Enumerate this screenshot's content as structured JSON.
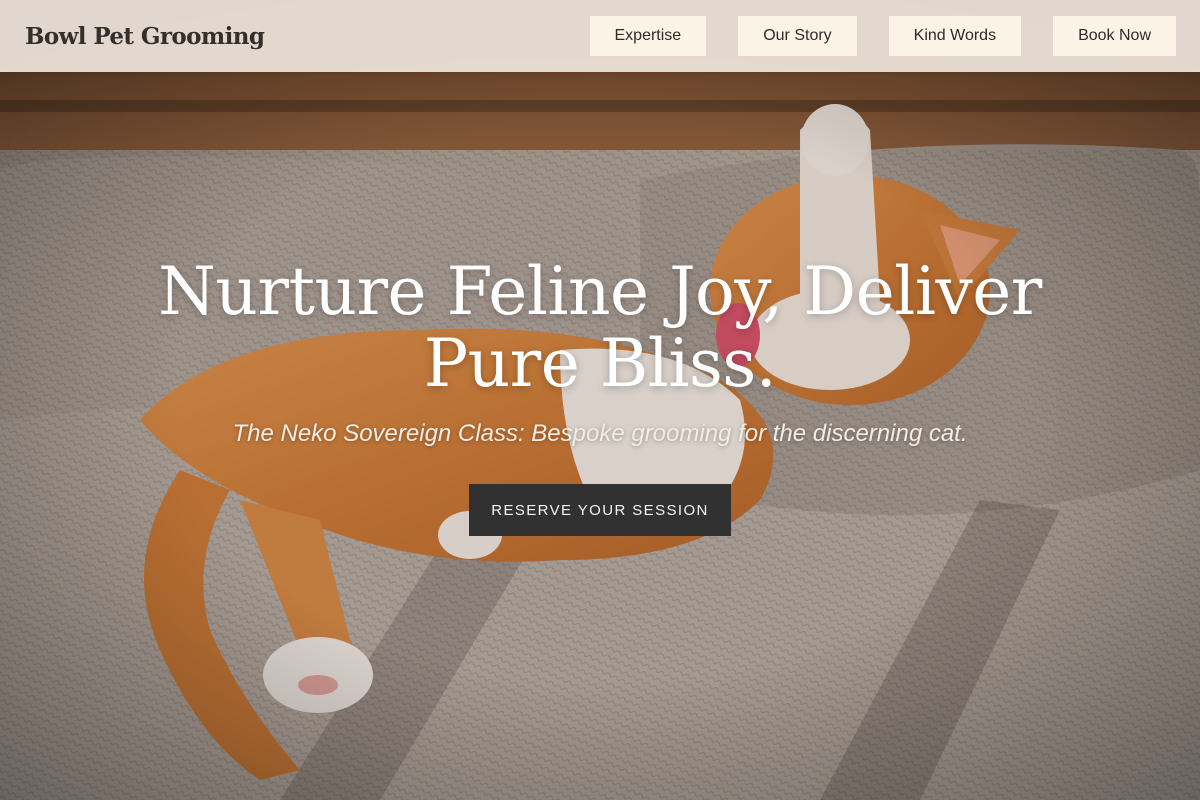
{
  "brand": {
    "name": "Bowl Pet Grooming"
  },
  "nav": {
    "items": [
      {
        "label": "Expertise"
      },
      {
        "label": "Our Story"
      },
      {
        "label": "Kind Words"
      },
      {
        "label": "Book Now"
      }
    ]
  },
  "hero": {
    "headline": "Nurture Feline Joy, Deliver Pure Bliss.",
    "subheadline": "The Neko Sovereign Class: Bespoke grooming for the discerning cat.",
    "cta_label": "RESERVE YOUR SESSION",
    "image": "orange-tabby-cat-on-sofa"
  },
  "colors": {
    "nav_bg": "#eee4db",
    "nav_button_bg": "#fbf3e6",
    "cta_bg": "#313131",
    "text_dark": "#33302c"
  }
}
